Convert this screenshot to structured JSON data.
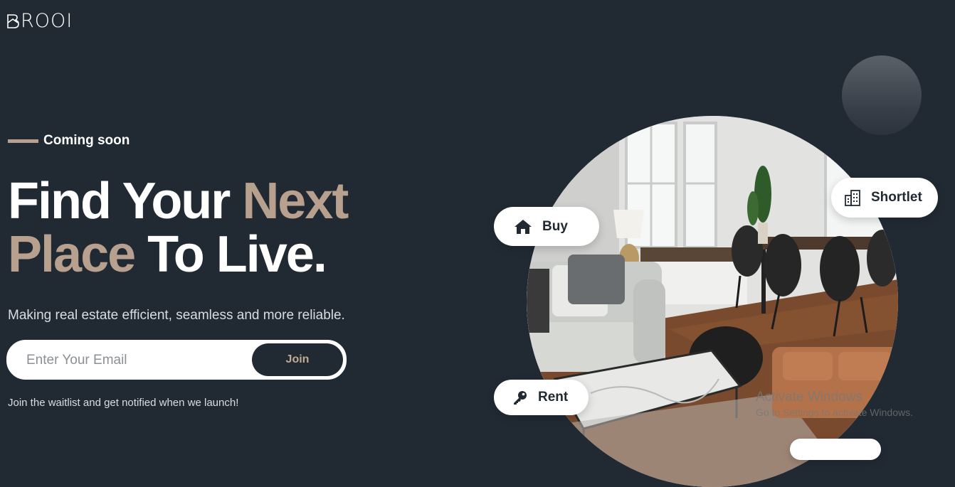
{
  "brand": {
    "logo_text": "ROOI",
    "logo_mark_icon": "b-house-mark-icon"
  },
  "hero": {
    "tag": "Coming soon",
    "headline_part1": "Find Your ",
    "headline_accent1": "Next",
    "headline_accent2": "Place",
    "headline_part2": " To Live.",
    "subtitle": "Making real estate efficient, seamless and more reliable."
  },
  "signup": {
    "email_placeholder": "Enter Your Email",
    "email_value": "",
    "join_label": "Join",
    "note": "Join the waitlist and get notified when we launch!"
  },
  "categories": [
    {
      "label": "Buy",
      "icon": "home-icon"
    },
    {
      "label": "Shortlet",
      "icon": "building-icon"
    },
    {
      "label": "Rent",
      "icon": "key-icon"
    }
  ],
  "watermark": {
    "title": "Activate Windows",
    "subtitle": "Go to Settings to activate Windows."
  },
  "colors": {
    "background": "#212a33",
    "accent": "#b8a08f",
    "text": "#ffffff",
    "pill_bg": "#ffffff"
  }
}
